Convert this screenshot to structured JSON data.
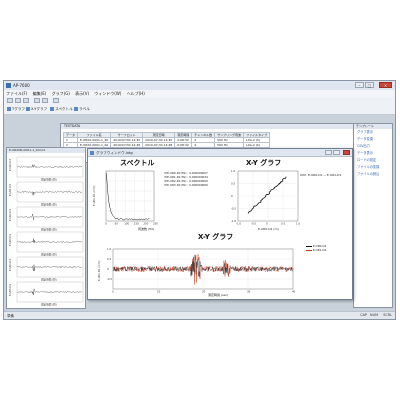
{
  "window": {
    "title": "AP-7600"
  },
  "menu": [
    "ファイル(F)",
    "編集(E)",
    "グラフ(G)",
    "表示(V)",
    "ウィンドウ(W)",
    "ヘルプ(H)"
  ],
  "toolbar2": [
    "Tグラフ",
    "X-Yグラフ",
    "スペクトル",
    "ラベル"
  ],
  "data_table": {
    "header_title": "TESTDATA",
    "columns": [
      "データ",
      "ファイル名",
      "サーフロット",
      "測定日時",
      "測定時間",
      "チャンネル数",
      "サンプリング周波",
      "ファイルタイプ"
    ],
    "rows": [
      [
        "1",
        "E-URX0-0001-1_S0",
        "2010/07/30 14:30",
        "2010-07-30 14:30",
        "0:08:32",
        "4",
        "500 Hz",
        "LXA-2 (S)"
      ],
      [
        "2",
        "E-URX0-0001-1_S0",
        "2010/07/30 14:36",
        "2010-07-30 14:38",
        "0:08:32",
        "4",
        "500 Hz",
        "LXA-2 (S)"
      ]
    ]
  },
  "side_panel": {
    "header": "テンプレート",
    "links": [
      "グラフ表示",
      "データ変換",
      "CSV出力",
      "データ表示",
      "ロードの設定",
      "ファイルの変換",
      "ファイルの読込"
    ]
  },
  "left_window": {
    "title": "E-URXN0-0001-1_S0.lxd",
    "xlabel": "測定時間 (秒)"
  },
  "graph_window": {
    "title": "グラフウィンドウ.lxtg",
    "spectrum": {
      "title": "スペクトル",
      "xlabel": "周波数 (Hz)",
      "ylabel": "E-UR0-D1 (mm)",
      "legend": [
        "(f)E-UR0-D1(Hz) : 0.000000007",
        "(f)E-UR1-D1(Hz) : 0.000000034",
        "(f)E-UR2-D1(Hz) : 0.000000000",
        "(f)E-UR3-D1(Hz) : 0.000000000"
      ],
      "xticks": [
        "0",
        "50",
        "100",
        "150",
        "200",
        "250"
      ]
    },
    "xy": {
      "title": "X-Y グラフ",
      "xlabel": "E-UR0-D1 (m)",
      "ylabel": "E-UR1-D1 (mm)",
      "legend": "E-UR0-D1 ~ E-UR1-D1",
      "xticks": [
        "-1.0",
        "-0.5",
        "0",
        "0.5",
        "1.0"
      ],
      "yticks": [
        "1.0",
        "0.5",
        "0",
        "-0.5",
        "-1.0"
      ]
    },
    "time": {
      "title": "X-Y グラフ",
      "xlabel": "測定時間 (sec)",
      "ylabel": "E-UR0-D1 (mm)",
      "legend": [
        "E-UR0-D1",
        "E-UR1-D1"
      ],
      "xticks": [
        "0",
        "10",
        "20",
        "30",
        "40"
      ],
      "yticks": [
        "1.0",
        "0.5",
        "0",
        "-0.5"
      ]
    }
  },
  "status": {
    "left": "準備",
    "right": [
      "CAP",
      "NUM",
      "SCRL"
    ]
  },
  "colors": {
    "accent": "#3a6fb0",
    "series1": "#111111",
    "series2": "#d23a1e",
    "close": "#c9463a"
  }
}
